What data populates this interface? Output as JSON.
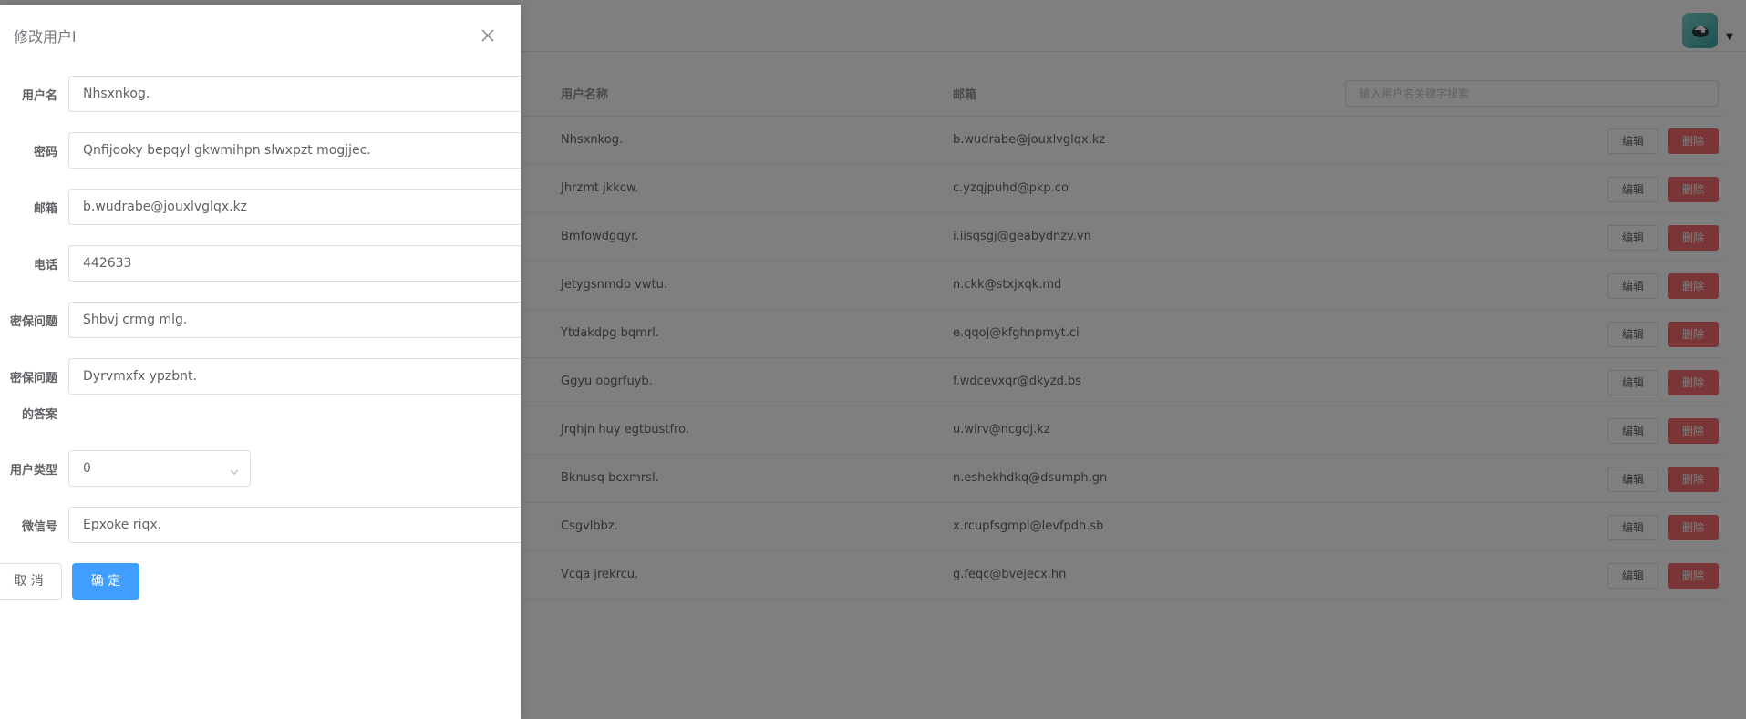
{
  "header": {
    "avatar_icon": "user-avatar-icon"
  },
  "table": {
    "columns": {
      "name": "用户名称",
      "email": "邮箱"
    },
    "search_placeholder": "输入用户名关键字搜索",
    "edit_label": "编辑",
    "delete_label": "删除",
    "rows": [
      {
        "name": "Nhsxnkog.",
        "email": "b.wudrabe@jouxlvglqx.kz"
      },
      {
        "name": "Jhrzmt jkkcw.",
        "email": "c.yzqjpuhd@pkp.co"
      },
      {
        "name": "Bmfowdgqyr.",
        "email": "i.iisqsgj@geabydnzv.vn"
      },
      {
        "name": "Jetygsnmdp vwtu.",
        "email": "n.ckk@stxjxqk.md"
      },
      {
        "name": "Ytdakdpg bqmrl.",
        "email": "e.qqoj@kfghnpmyt.ci"
      },
      {
        "name": "Ggyu oogrfuyb.",
        "email": "f.wdcevxqr@dkyzd.bs"
      },
      {
        "name": "Jrqhjn huy egtbustfro.",
        "email": "u.wirv@ncgdj.kz"
      },
      {
        "name": "Bknusq bcxmrsl.",
        "email": "n.eshekhdkq@dsumph.gn"
      },
      {
        "name": "Csgvlbbz.",
        "email": "x.rcupfsgmpi@levfpdh.sb"
      },
      {
        "name": "Vcqa jrekrcu.",
        "email": "g.feqc@bvejecx.hn"
      }
    ]
  },
  "drawer": {
    "title": "修改用户l",
    "fields": {
      "username": {
        "label": "用户名",
        "value": "Nhsxnkog."
      },
      "password": {
        "label": "密码",
        "value": "Qnfijooky bepqyl gkwmihpn slwxpzt mogjjec."
      },
      "email": {
        "label": "邮箱",
        "value": "b.wudrabe@jouxlvglqx.kz"
      },
      "phone": {
        "label": "电话",
        "value": "442633"
      },
      "security_question": {
        "label": "密保问题",
        "value": "Shbvj crmg mlg."
      },
      "security_answer": {
        "label_line1": "密保问题",
        "label_line2": "的答案",
        "value": "Dyrvmxfx ypzbnt."
      },
      "user_type": {
        "label": "用户类型",
        "value": "0"
      },
      "wechat": {
        "label": "微信号",
        "value": "Epxoke riqx."
      }
    },
    "cancel_label": "取 消",
    "confirm_label": "确 定"
  },
  "colors": {
    "primary": "#409eff",
    "danger": "#f56c6c",
    "overlay": "rgba(0,0,0,0.5)"
  }
}
